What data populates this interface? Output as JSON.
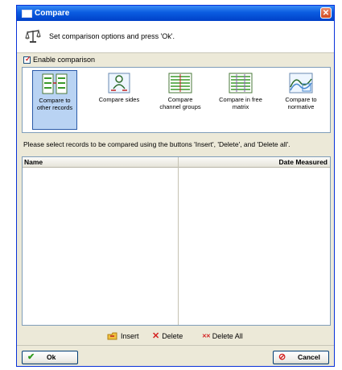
{
  "window": {
    "title": "Compare"
  },
  "header": {
    "text": "Set comparison options and press 'Ok'."
  },
  "enable": {
    "label": "Enable comparison",
    "checked": true
  },
  "options": [
    {
      "label": "Compare to other records",
      "line1": "Compare to",
      "line2": "other records",
      "selected": true,
      "icon": "compare-records-icon"
    },
    {
      "label": "Compare sides",
      "line1": "Compare sides",
      "line2": "",
      "selected": false,
      "icon": "compare-sides-icon"
    },
    {
      "label": "Compare channel groups",
      "line1": "Compare",
      "line2": "channel groups",
      "selected": false,
      "icon": "compare-channel-groups-icon"
    },
    {
      "label": "Compare in free matrix",
      "line1": "Compare in free",
      "line2": "matrix",
      "selected": false,
      "icon": "compare-free-matrix-icon"
    },
    {
      "label": "Compare to normative",
      "line1": "Compare to",
      "line2": "normative",
      "selected": false,
      "icon": "compare-normative-icon"
    }
  ],
  "instruction": "Please select records to be compared using the buttons 'Insert', 'Delete', and 'Delete all'.",
  "table": {
    "columns": [
      "Name",
      "Date Measured"
    ],
    "rows": []
  },
  "actions": {
    "insert": "Insert",
    "delete": "Delete",
    "delete_all": "Delete All"
  },
  "buttons": {
    "ok": "Ok",
    "cancel": "Cancel"
  },
  "colors": {
    "titlebar": "#0a5ce0",
    "selected_bg": "#b9d3f3",
    "ok_icon": "#2e9a1c",
    "cancel_icon": "#d42020"
  }
}
